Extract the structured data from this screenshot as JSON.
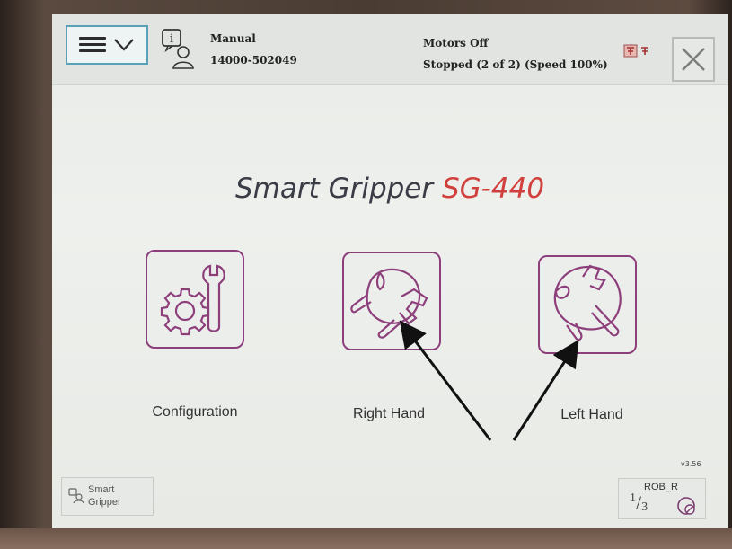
{
  "header": {
    "mode": "Manual",
    "controller_id": "14000-502049",
    "motor_state": "Motors Off",
    "run_state": "Stopped (2 of 2) (Speed 100%)"
  },
  "main": {
    "title_prefix": "Smart Gripper",
    "title_model": "SG-440",
    "tiles": [
      {
        "label": "Configuration",
        "icon": "gear-wrench-icon"
      },
      {
        "label": "Right Hand",
        "icon": "right-hand-gripper-icon"
      },
      {
        "label": "Left Hand",
        "icon": "left-hand-gripper-icon"
      }
    ]
  },
  "footer": {
    "version": "v3.56",
    "task_line1": "Smart",
    "task_line2": "Gripper",
    "robot": "ROB_R",
    "quickset_fraction_num": "1",
    "quickset_fraction_den": "3"
  },
  "colors": {
    "accent_title": "#d0403c",
    "tile_border": "#8d3f7b",
    "menu_border": "#5aa0b8"
  }
}
